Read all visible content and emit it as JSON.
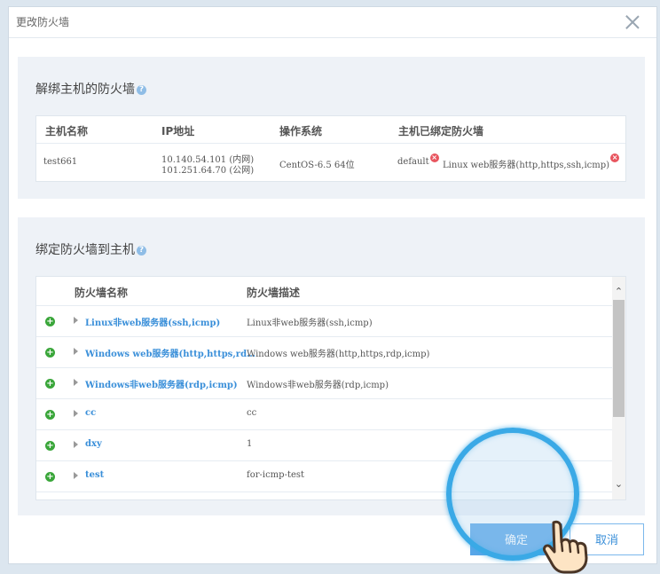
{
  "dialog": {
    "title": "更改防火墙"
  },
  "unbind_section": {
    "title": "解绑主机的防火墙",
    "help": "?",
    "columns": [
      "主机名称",
      "IP地址",
      "操作系统",
      "主机已绑定防火墙"
    ],
    "host": {
      "name": "test661",
      "ip_private": "10.140.54.101 (内网)",
      "ip_public": "101.251.64.70 (公网)",
      "os": "CentOS-6.5 64位",
      "firewalls": [
        "default",
        "Linux web服务器(http,https,ssh,icmp)"
      ],
      "remove_glyph": "×"
    }
  },
  "bind_section": {
    "title": "绑定防火墙到主机",
    "help": "?",
    "columns": [
      "防火墙名称",
      "防火墙描述"
    ],
    "add_glyph": "+",
    "rows": [
      {
        "name": "Linux非web服务器(ssh,icmp)",
        "desc": "Linux非web服务器(ssh,icmp)"
      },
      {
        "name": "Windows web服务器(http,https,rd…",
        "desc": "Windows web服务器(http,https,rdp,icmp)"
      },
      {
        "name": "Windows非web服务器(rdp,icmp)",
        "desc": "Windows非web服务器(rdp,icmp)"
      },
      {
        "name": "cc",
        "desc": "cc"
      },
      {
        "name": "dxy",
        "desc": "1"
      },
      {
        "name": "test",
        "desc": "for-icmp-test"
      }
    ]
  },
  "buttons": {
    "ok": "确定",
    "cancel": "取消"
  },
  "colors": {
    "accent": "#3a8fd9",
    "add": "#3aa63a",
    "remove": "#e8555f",
    "highlight_ring": "#3aa9e6"
  }
}
